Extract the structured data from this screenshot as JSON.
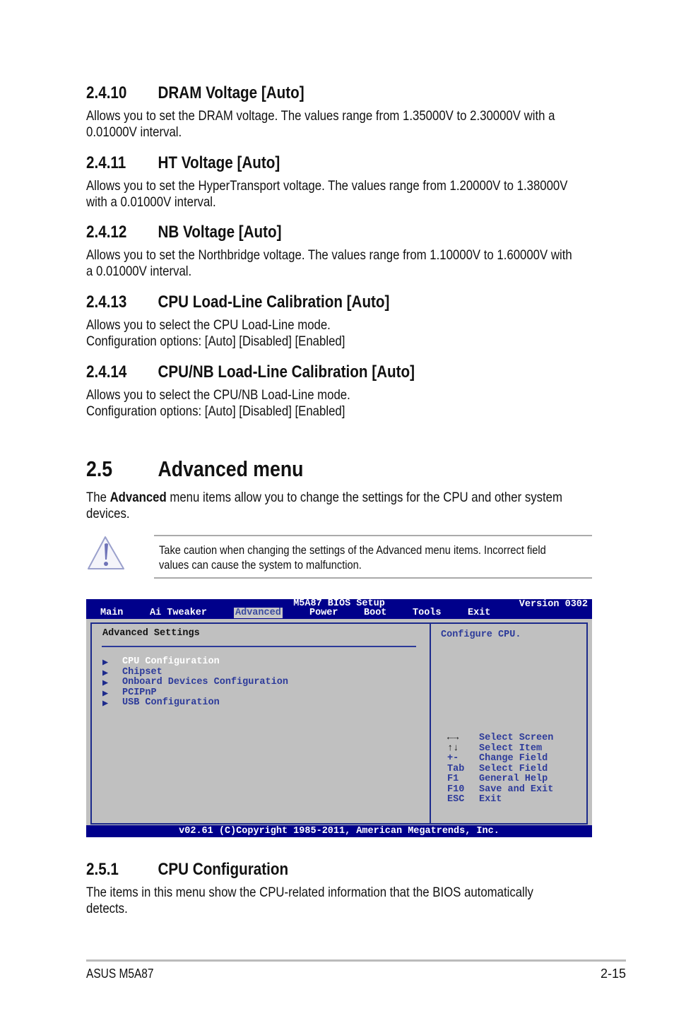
{
  "sections": [
    {
      "num": "2.4.10",
      "title": "DRAM Voltage [Auto]",
      "lines": [
        "Allows you to set the DRAM voltage. The values range from 1.35000V to 2.30000V with a",
        "0.01000V interval."
      ]
    },
    {
      "num": "2.4.11",
      "title": "HT Voltage [Auto]",
      "lines": [
        "Allows you to set the HyperTransport voltage. The values range from 1.20000V to 1.38000V",
        "with a 0.01000V interval."
      ]
    },
    {
      "num": "2.4.12",
      "title": "NB Voltage [Auto]",
      "lines": [
        "Allows you to set the Northbridge voltage. The values range from 1.10000V to 1.60000V with",
        "a 0.01000V interval."
      ]
    },
    {
      "num": "2.4.13",
      "title": "CPU Load-Line Calibration [Auto]",
      "lines": [
        "Allows you to select the CPU Load-Line mode.",
        "Configuration options: [Auto] [Disabled] [Enabled]"
      ]
    },
    {
      "num": "2.4.14",
      "title": "CPU/NB Load-Line Calibration [Auto]",
      "lines": [
        "Allows you to select the CPU/NB Load-Line mode.",
        "Configuration options: [Auto] [Disabled] [Enabled]"
      ]
    }
  ],
  "advanced": {
    "num": "2.5",
    "title": "Advanced menu",
    "intro_pre": "The ",
    "intro_bold": "Advanced",
    "intro_post": " menu items allow you to change the settings for the CPU and other system",
    "intro_line2": "devices."
  },
  "note": {
    "icon": "warning-icon",
    "lines": [
      "Take caution when changing the settings of the Advanced menu items. Incorrect field",
      "values can cause the system to malfunction."
    ]
  },
  "bios": {
    "title": "M5A87 BIOS Setup",
    "version": "Version 0302",
    "tabs": [
      "Main",
      "Ai Tweaker",
      "Advanced",
      "Power",
      "Boot",
      "Tools",
      "Exit"
    ],
    "selected_tab": "Advanced",
    "heading": "Advanced Settings",
    "items": [
      "CPU Configuration",
      "Chipset",
      "Onboard Devices Configuration",
      "PCIPnP",
      "USB Configuration"
    ],
    "help": "Configure CPU.",
    "keys": [
      {
        "key": "←→",
        "action": "Select Screen"
      },
      {
        "key": "↑↓",
        "action": "Select Item"
      },
      {
        "key": "+-",
        "action": "Change Field"
      },
      {
        "key": "Tab",
        "action": "Select Field"
      },
      {
        "key": "F1",
        "action": "General Help"
      },
      {
        "key": "F10",
        "action": "Save and Exit"
      },
      {
        "key": "ESC",
        "action": "Exit"
      }
    ],
    "copyright": "v02.61 (C)Copyright 1985-2011, American Megatrends, Inc.",
    "colors": {
      "bar": "#00008b",
      "panel": "#c0c0c0",
      "text": "#2c3a9a"
    }
  },
  "cpu_config": {
    "num": "2.5.1",
    "title": "CPU Configuration",
    "lines": [
      "The items in this menu show the CPU-related information that the BIOS automatically",
      "detects."
    ]
  },
  "footer": {
    "left": "ASUS M5A87",
    "right": "2-15"
  }
}
